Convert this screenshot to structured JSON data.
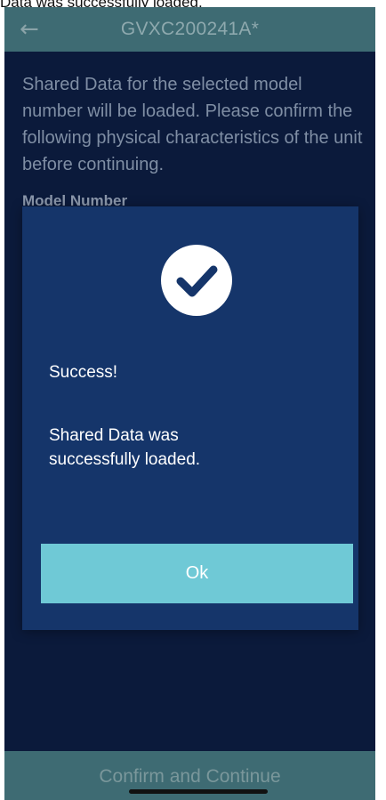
{
  "top_caption": "Data was successfully loaded.",
  "header": {
    "back_icon": "arrow-left-icon",
    "title": "GVXC200241A*"
  },
  "intro_text": "Shared Data for the selected model number will be loaded. Please confirm the following physical characteristics of the unit before continuing.",
  "section_label": "Model Number",
  "dialog": {
    "icon": "check-circle-icon",
    "title": "Success!",
    "message": "Shared Data was successfully loaded.",
    "ok_label": "Ok"
  },
  "footer": {
    "confirm_label": "Confirm and Continue"
  },
  "colors": {
    "header_bg": "#3e6b73",
    "screen_bg": "#0b1a3b",
    "dialog_bg": "#15356a",
    "ok_button_bg": "#6fc9d6",
    "check_color": "#15356a"
  }
}
